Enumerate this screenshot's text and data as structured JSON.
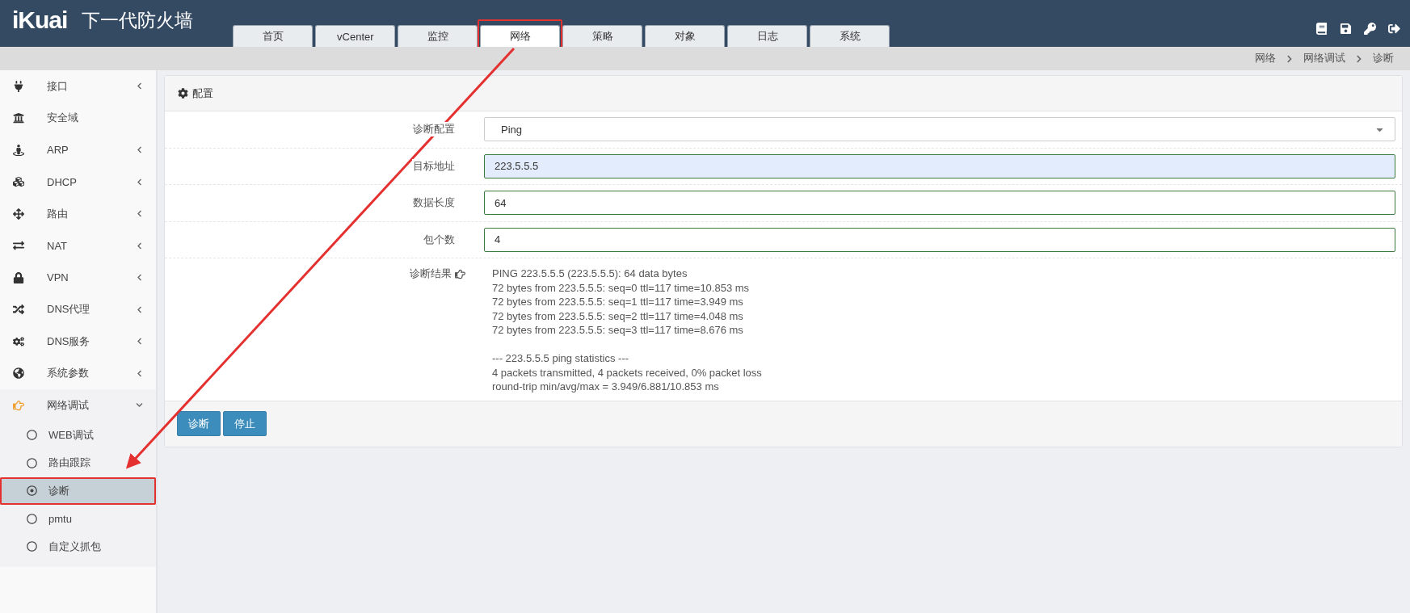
{
  "header": {
    "logo": "iKuai",
    "title": "下一代防火墙",
    "tabs": [
      {
        "label": "首页",
        "selected": false,
        "annotated": false
      },
      {
        "label": "vCenter",
        "selected": false,
        "annotated": false
      },
      {
        "label": "监控",
        "selected": false,
        "annotated": false
      },
      {
        "label": "网络",
        "selected": true,
        "annotated": true
      },
      {
        "label": "策略",
        "selected": false,
        "annotated": false
      },
      {
        "label": "对象",
        "selected": false,
        "annotated": false
      },
      {
        "label": "日志",
        "selected": false,
        "annotated": false
      },
      {
        "label": "系统",
        "selected": false,
        "annotated": false
      }
    ]
  },
  "breadcrumb": [
    "网络",
    "网络调试",
    "诊断"
  ],
  "sidebar": {
    "items": [
      {
        "label": "接口",
        "expandable": true,
        "expanded": false
      },
      {
        "label": "安全域",
        "expandable": false,
        "expanded": false
      },
      {
        "label": "ARP",
        "expandable": true,
        "expanded": false
      },
      {
        "label": "DHCP",
        "expandable": true,
        "expanded": false
      },
      {
        "label": "路由",
        "expandable": true,
        "expanded": false
      },
      {
        "label": "NAT",
        "expandable": true,
        "expanded": false
      },
      {
        "label": "VPN",
        "expandable": true,
        "expanded": false
      },
      {
        "label": "DNS代理",
        "expandable": true,
        "expanded": false
      },
      {
        "label": "DNS服务",
        "expandable": true,
        "expanded": false
      },
      {
        "label": "系统参数",
        "expandable": true,
        "expanded": false
      },
      {
        "label": "网络调试",
        "expandable": true,
        "expanded": true,
        "children": [
          {
            "label": "WEB调试",
            "selected": false,
            "annotated": false
          },
          {
            "label": "路由跟踪",
            "selected": false,
            "annotated": false
          },
          {
            "label": "诊断",
            "selected": true,
            "annotated": true
          },
          {
            "label": "pmtu",
            "selected": false,
            "annotated": false
          },
          {
            "label": "自定义抓包",
            "selected": false,
            "annotated": false
          }
        ]
      }
    ]
  },
  "panel": {
    "title": "配置",
    "fields": [
      {
        "label": "诊断配置",
        "kind": "select",
        "value": "Ping"
      },
      {
        "label": "目标地址",
        "kind": "text",
        "value": "223.5.5.5",
        "autofilled": true
      },
      {
        "label": "数据长度",
        "kind": "text",
        "value": "64",
        "autofilled": false
      },
      {
        "label": "包个数",
        "kind": "text",
        "value": "4",
        "autofilled": false
      }
    ],
    "result": {
      "label": "诊断结果",
      "blocks": [
        [
          "PING 223.5.5.5 (223.5.5.5): 64 data bytes",
          "72 bytes from 223.5.5.5: seq=0 ttl=117 time=10.853 ms",
          "72 bytes from 223.5.5.5: seq=1 ttl=117 time=3.949 ms",
          "72 bytes from 223.5.5.5: seq=2 ttl=117 time=4.048 ms",
          "72 bytes from 223.5.5.5: seq=3 ttl=117 time=8.676 ms"
        ],
        [
          "--- 223.5.5.5 ping statistics ---",
          "4 packets transmitted, 4 packets received, 0% packet loss",
          "round-trip min/avg/max = 3.949/6.881/10.853 ms"
        ]
      ]
    },
    "buttons": [
      "诊断",
      "停止"
    ]
  }
}
